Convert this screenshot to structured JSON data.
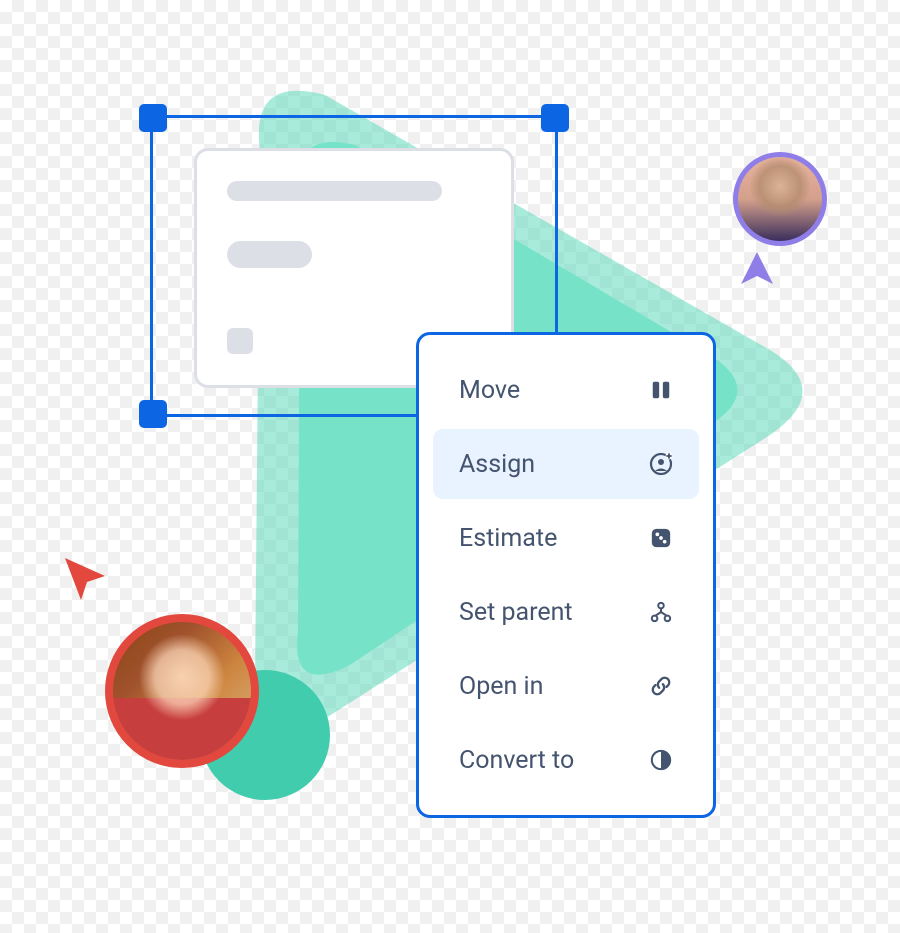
{
  "menu": {
    "items": [
      {
        "label": "Move",
        "icon": "columns-icon",
        "highlighted": false
      },
      {
        "label": "Assign",
        "icon": "assign-person-icon",
        "highlighted": true
      },
      {
        "label": "Estimate",
        "icon": "dice-icon",
        "highlighted": false
      },
      {
        "label": "Set parent",
        "icon": "hierarchy-icon",
        "highlighted": false
      },
      {
        "label": "Open in",
        "icon": "link-icon",
        "highlighted": false
      },
      {
        "label": "Convert to",
        "icon": "half-circle-icon",
        "highlighted": false
      }
    ]
  },
  "colors": {
    "selection": "#0C66E4",
    "highlight": "#E9F2FF",
    "text": "#44546F",
    "placeholder": "#DCDFE5",
    "green": "#62DABE",
    "red": "#E2483D",
    "purple": "#8F7EE7"
  }
}
